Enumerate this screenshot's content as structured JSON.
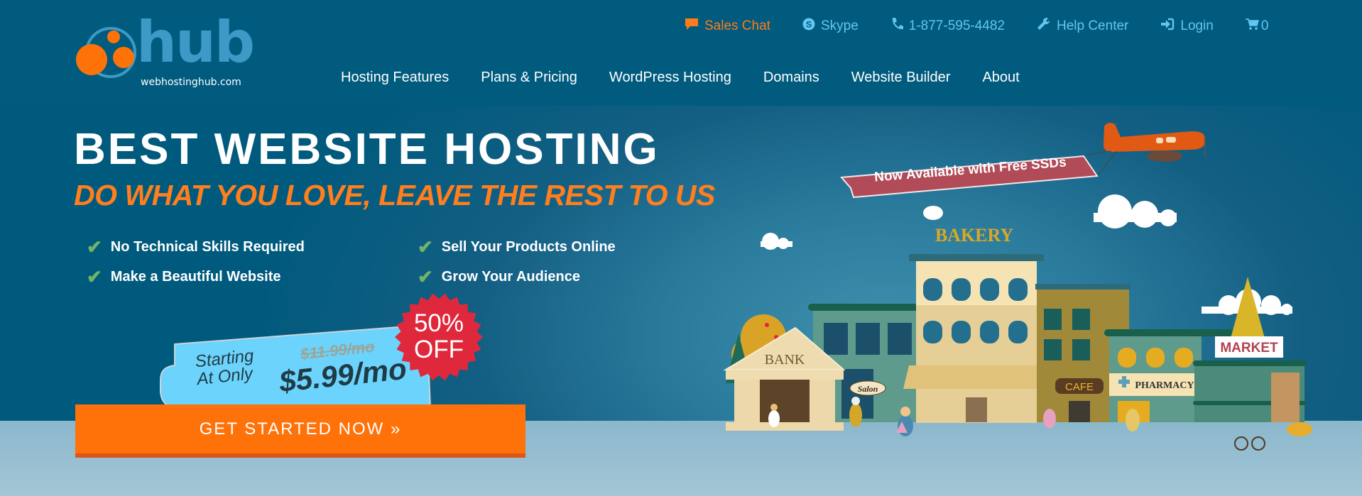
{
  "logo": {
    "word": "hub",
    "domain": "webhostinghub.com"
  },
  "utility_nav": [
    {
      "label": "Sales Chat",
      "icon": "chat-bubble-icon"
    },
    {
      "label": "Skype",
      "icon": "skype-icon"
    },
    {
      "label": "1-877-595-4482",
      "icon": "phone-icon"
    },
    {
      "label": "Help Center",
      "icon": "wrench-icon"
    },
    {
      "label": "Login",
      "icon": "login-icon"
    },
    {
      "label": "0",
      "icon": "cart-icon"
    }
  ],
  "main_nav": [
    "Hosting Features",
    "Plans & Pricing",
    "WordPress Hosting",
    "Domains",
    "Website Builder",
    "About"
  ],
  "hero": {
    "title": "BEST WEBSITE HOSTING",
    "subtitle": "DO WHAT YOU LOVE, LEAVE THE REST TO US",
    "features": [
      "No Technical Skills Required",
      "Sell Your Products Online",
      "Make a Beautiful Website",
      "Grow Your Audience"
    ],
    "check_glyph": "✔"
  },
  "pricing": {
    "starting_line1": "Starting",
    "starting_line2": "At Only",
    "old_price": "$11.99/mo",
    "new_price": "$5.99/mo",
    "badge_line1": "50%",
    "badge_line2": "OFF"
  },
  "cta": {
    "label": "GET STARTED NOW »"
  },
  "illustration": {
    "banner_text": "Now Available with Free SSDs",
    "signs": {
      "bank": "BANK",
      "salon": "Salon",
      "bakery": "BAKERY",
      "cafe": "CAFE",
      "pharmacy": "PHARMACY",
      "market": "MARKET"
    }
  },
  "colors": {
    "header_bg": "#005b7e",
    "accent_orange": "#ff7209",
    "link_blue": "#62c6f0",
    "badge_red": "#e0283c",
    "price_tag_blue": "#6cd3fc",
    "check_green": "#73b368"
  }
}
